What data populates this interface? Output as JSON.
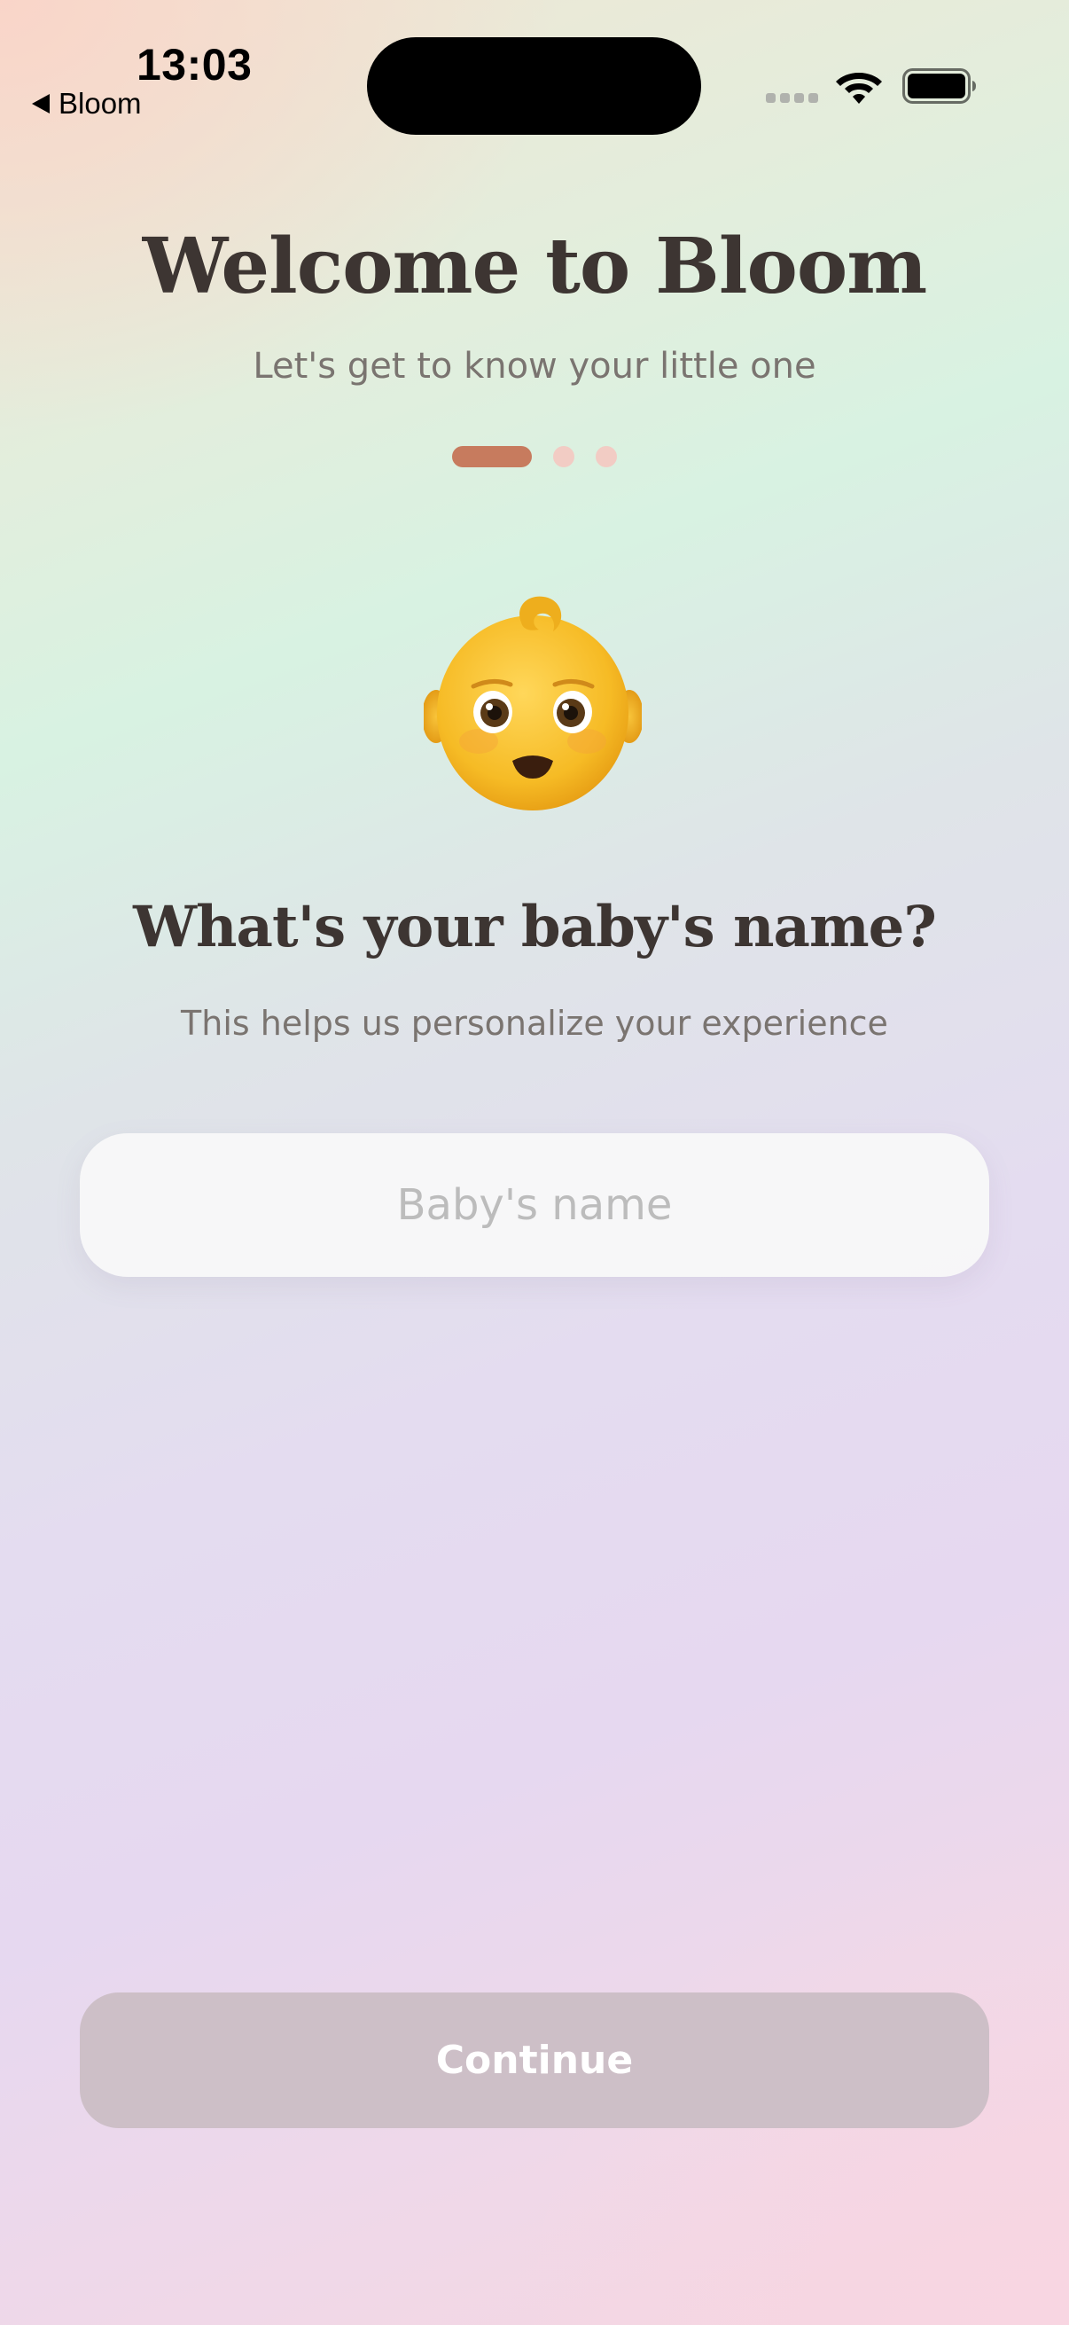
{
  "status_bar": {
    "time": "13:03",
    "back_label": "Bloom"
  },
  "header": {
    "title": "Welcome to Bloom",
    "subtitle": "Let's get to know your little one"
  },
  "progress": {
    "current_step": 1,
    "total_steps": 3
  },
  "question": {
    "icon": "baby-face-icon",
    "title": "What's your baby's name?",
    "subtitle": "This helps us personalize your experience"
  },
  "name_input": {
    "placeholder": "Baby's name",
    "value": ""
  },
  "actions": {
    "continue_label": "Continue",
    "continue_enabled": false
  },
  "colors": {
    "accent": "#c77b5e",
    "step_inactive": "#f2ccc4",
    "text_primary": "#3d3532",
    "text_secondary": "#7a7470",
    "button_disabled": "#cdbfc7"
  }
}
